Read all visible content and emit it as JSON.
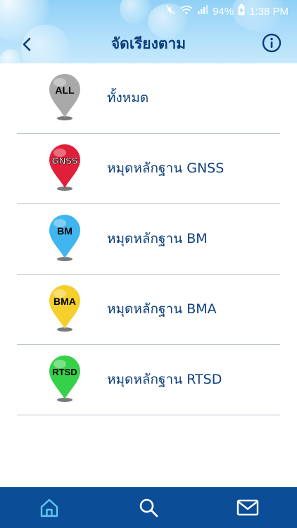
{
  "status": {
    "battery": "94%",
    "time": "1:38 PM"
  },
  "header": {
    "title": "จัดเรียงตาม"
  },
  "items": [
    {
      "label": "ทั้งหมด",
      "pin_text": "ALL",
      "color": "#a9a9a9"
    },
    {
      "label": "หมุดหลักฐาน GNSS",
      "pin_text": "GNSS",
      "color": "#e0203a"
    },
    {
      "label": "หมุดหลักฐาน BM",
      "pin_text": "BM",
      "color": "#3fb6ef"
    },
    {
      "label": "หมุดหลักฐาน BMA",
      "pin_text": "BMA",
      "color": "#f5cf2b"
    },
    {
      "label": "หมุดหลักฐาน RTSD",
      "pin_text": "RTSD",
      "color": "#36d14a"
    }
  ],
  "tabbar": {
    "icons": [
      "home-icon",
      "search-icon",
      "mail-icon"
    ]
  }
}
